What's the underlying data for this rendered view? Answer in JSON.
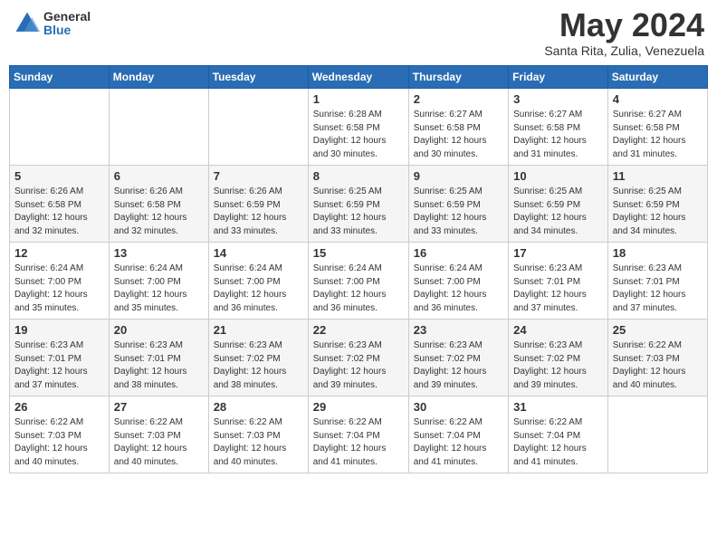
{
  "header": {
    "logo": {
      "general": "General",
      "blue": "Blue"
    },
    "title": "May 2024",
    "location": "Santa Rita, Zulia, Venezuela"
  },
  "calendar": {
    "days_of_week": [
      "Sunday",
      "Monday",
      "Tuesday",
      "Wednesday",
      "Thursday",
      "Friday",
      "Saturday"
    ],
    "weeks": [
      [
        {
          "day": "",
          "info": ""
        },
        {
          "day": "",
          "info": ""
        },
        {
          "day": "",
          "info": ""
        },
        {
          "day": "1",
          "info": "Sunrise: 6:28 AM\nSunset: 6:58 PM\nDaylight: 12 hours\nand 30 minutes."
        },
        {
          "day": "2",
          "info": "Sunrise: 6:27 AM\nSunset: 6:58 PM\nDaylight: 12 hours\nand 30 minutes."
        },
        {
          "day": "3",
          "info": "Sunrise: 6:27 AM\nSunset: 6:58 PM\nDaylight: 12 hours\nand 31 minutes."
        },
        {
          "day": "4",
          "info": "Sunrise: 6:27 AM\nSunset: 6:58 PM\nDaylight: 12 hours\nand 31 minutes."
        }
      ],
      [
        {
          "day": "5",
          "info": "Sunrise: 6:26 AM\nSunset: 6:58 PM\nDaylight: 12 hours\nand 32 minutes."
        },
        {
          "day": "6",
          "info": "Sunrise: 6:26 AM\nSunset: 6:58 PM\nDaylight: 12 hours\nand 32 minutes."
        },
        {
          "day": "7",
          "info": "Sunrise: 6:26 AM\nSunset: 6:59 PM\nDaylight: 12 hours\nand 33 minutes."
        },
        {
          "day": "8",
          "info": "Sunrise: 6:25 AM\nSunset: 6:59 PM\nDaylight: 12 hours\nand 33 minutes."
        },
        {
          "day": "9",
          "info": "Sunrise: 6:25 AM\nSunset: 6:59 PM\nDaylight: 12 hours\nand 33 minutes."
        },
        {
          "day": "10",
          "info": "Sunrise: 6:25 AM\nSunset: 6:59 PM\nDaylight: 12 hours\nand 34 minutes."
        },
        {
          "day": "11",
          "info": "Sunrise: 6:25 AM\nSunset: 6:59 PM\nDaylight: 12 hours\nand 34 minutes."
        }
      ],
      [
        {
          "day": "12",
          "info": "Sunrise: 6:24 AM\nSunset: 7:00 PM\nDaylight: 12 hours\nand 35 minutes."
        },
        {
          "day": "13",
          "info": "Sunrise: 6:24 AM\nSunset: 7:00 PM\nDaylight: 12 hours\nand 35 minutes."
        },
        {
          "day": "14",
          "info": "Sunrise: 6:24 AM\nSunset: 7:00 PM\nDaylight: 12 hours\nand 36 minutes."
        },
        {
          "day": "15",
          "info": "Sunrise: 6:24 AM\nSunset: 7:00 PM\nDaylight: 12 hours\nand 36 minutes."
        },
        {
          "day": "16",
          "info": "Sunrise: 6:24 AM\nSunset: 7:00 PM\nDaylight: 12 hours\nand 36 minutes."
        },
        {
          "day": "17",
          "info": "Sunrise: 6:23 AM\nSunset: 7:01 PM\nDaylight: 12 hours\nand 37 minutes."
        },
        {
          "day": "18",
          "info": "Sunrise: 6:23 AM\nSunset: 7:01 PM\nDaylight: 12 hours\nand 37 minutes."
        }
      ],
      [
        {
          "day": "19",
          "info": "Sunrise: 6:23 AM\nSunset: 7:01 PM\nDaylight: 12 hours\nand 37 minutes."
        },
        {
          "day": "20",
          "info": "Sunrise: 6:23 AM\nSunset: 7:01 PM\nDaylight: 12 hours\nand 38 minutes."
        },
        {
          "day": "21",
          "info": "Sunrise: 6:23 AM\nSunset: 7:02 PM\nDaylight: 12 hours\nand 38 minutes."
        },
        {
          "day": "22",
          "info": "Sunrise: 6:23 AM\nSunset: 7:02 PM\nDaylight: 12 hours\nand 39 minutes."
        },
        {
          "day": "23",
          "info": "Sunrise: 6:23 AM\nSunset: 7:02 PM\nDaylight: 12 hours\nand 39 minutes."
        },
        {
          "day": "24",
          "info": "Sunrise: 6:23 AM\nSunset: 7:02 PM\nDaylight: 12 hours\nand 39 minutes."
        },
        {
          "day": "25",
          "info": "Sunrise: 6:22 AM\nSunset: 7:03 PM\nDaylight: 12 hours\nand 40 minutes."
        }
      ],
      [
        {
          "day": "26",
          "info": "Sunrise: 6:22 AM\nSunset: 7:03 PM\nDaylight: 12 hours\nand 40 minutes."
        },
        {
          "day": "27",
          "info": "Sunrise: 6:22 AM\nSunset: 7:03 PM\nDaylight: 12 hours\nand 40 minutes."
        },
        {
          "day": "28",
          "info": "Sunrise: 6:22 AM\nSunset: 7:03 PM\nDaylight: 12 hours\nand 40 minutes."
        },
        {
          "day": "29",
          "info": "Sunrise: 6:22 AM\nSunset: 7:04 PM\nDaylight: 12 hours\nand 41 minutes."
        },
        {
          "day": "30",
          "info": "Sunrise: 6:22 AM\nSunset: 7:04 PM\nDaylight: 12 hours\nand 41 minutes."
        },
        {
          "day": "31",
          "info": "Sunrise: 6:22 AM\nSunset: 7:04 PM\nDaylight: 12 hours\nand 41 minutes."
        },
        {
          "day": "",
          "info": ""
        }
      ]
    ]
  }
}
